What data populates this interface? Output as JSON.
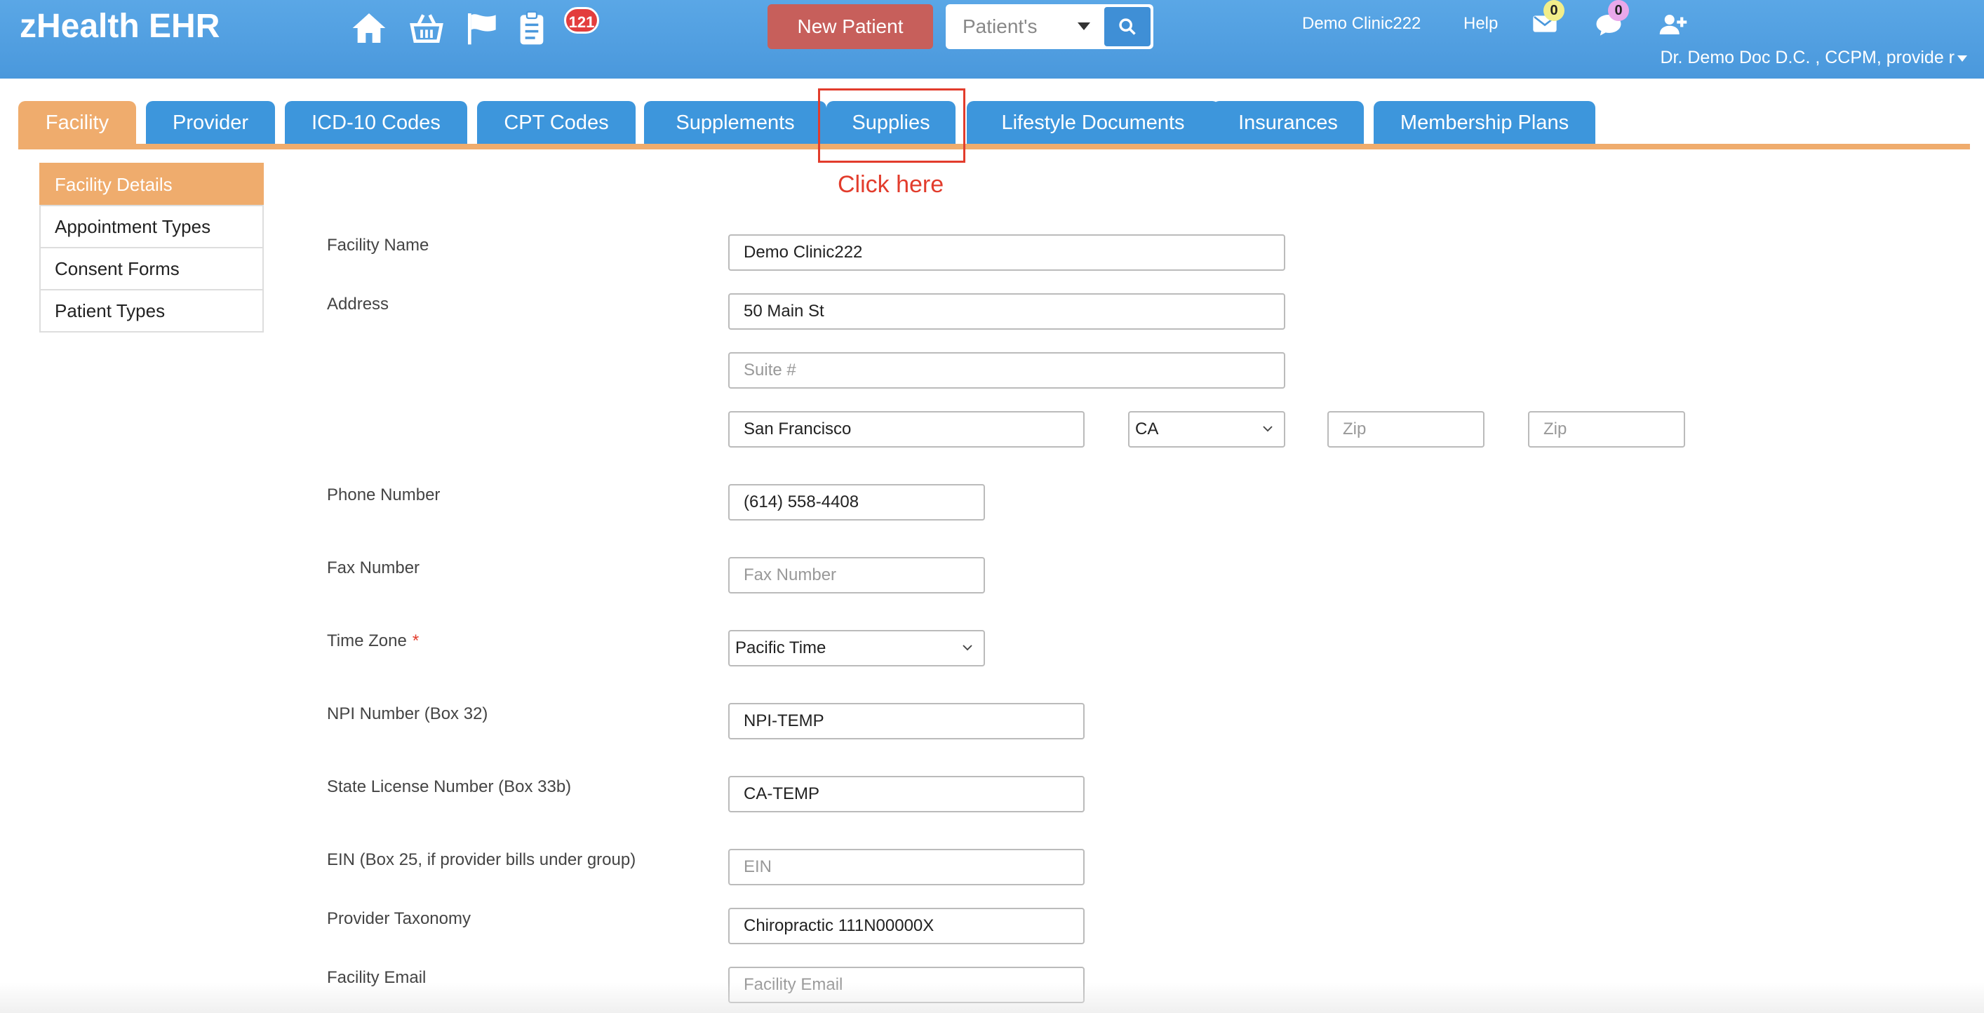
{
  "header": {
    "brand": "zHealth EHR",
    "nav_icons": [
      "home-icon",
      "basket-icon",
      "flag-icon",
      "clipboard-icon"
    ],
    "clipboard_badge": "121",
    "new_patient_label": "New Patient",
    "search_select_label": "Patient's",
    "clinic_link": "Demo Clinic222",
    "help_link": "Help",
    "mail_count": "0",
    "chat_count": "0",
    "user_name": "Dr. Demo Doc D.C. , CCPM, provide r"
  },
  "tabs": [
    {
      "label": "Facility",
      "active": true
    },
    {
      "label": "Provider"
    },
    {
      "label": "ICD-10 Codes"
    },
    {
      "label": "CPT Codes"
    },
    {
      "label": "Supplements"
    },
    {
      "label": "Supplies"
    },
    {
      "label": "Lifestyle Documents"
    },
    {
      "label": "Insurances"
    },
    {
      "label": "Membership Plans"
    }
  ],
  "annotation": {
    "text": "Click here"
  },
  "side_menu": [
    {
      "label": "Facility Details",
      "active": true
    },
    {
      "label": "Appointment Types"
    },
    {
      "label": "Consent Forms"
    },
    {
      "label": "Patient Types"
    }
  ],
  "form": {
    "facility_name": {
      "label": "Facility Name",
      "value": "Demo Clinic222"
    },
    "address": {
      "label": "Address",
      "value": "50 Main St"
    },
    "suite": {
      "placeholder": "Suite #"
    },
    "city": {
      "value": "San Francisco"
    },
    "state": {
      "value": "CA"
    },
    "zip1": {
      "placeholder": "Zip"
    },
    "zip2": {
      "placeholder": "Zip"
    },
    "phone": {
      "label": "Phone Number",
      "value": "(614) 558-4408"
    },
    "fax": {
      "label": "Fax Number",
      "placeholder": "Fax Number"
    },
    "timezone": {
      "label": "Time Zone",
      "required_mark": "*",
      "value": "Pacific Time"
    },
    "npi": {
      "label": "NPI Number (Box 32)",
      "value": "NPI-TEMP"
    },
    "state_license": {
      "label": "State License Number (Box 33b)",
      "value": "CA-TEMP"
    },
    "ein": {
      "label": "EIN (Box 25, if provider bills under group)",
      "placeholder": "EIN"
    },
    "taxonomy": {
      "label": "Provider Taxonomy",
      "value": "Chiropractic 111N00000X"
    },
    "email": {
      "label": "Facility Email",
      "placeholder": "Facility Email"
    }
  },
  "colors": {
    "header": "#4a98dc",
    "tab": "#3d96dc",
    "active_tab": "#efac6d",
    "new_patient": "#c75f5b",
    "annotation": "#e23c2c"
  }
}
